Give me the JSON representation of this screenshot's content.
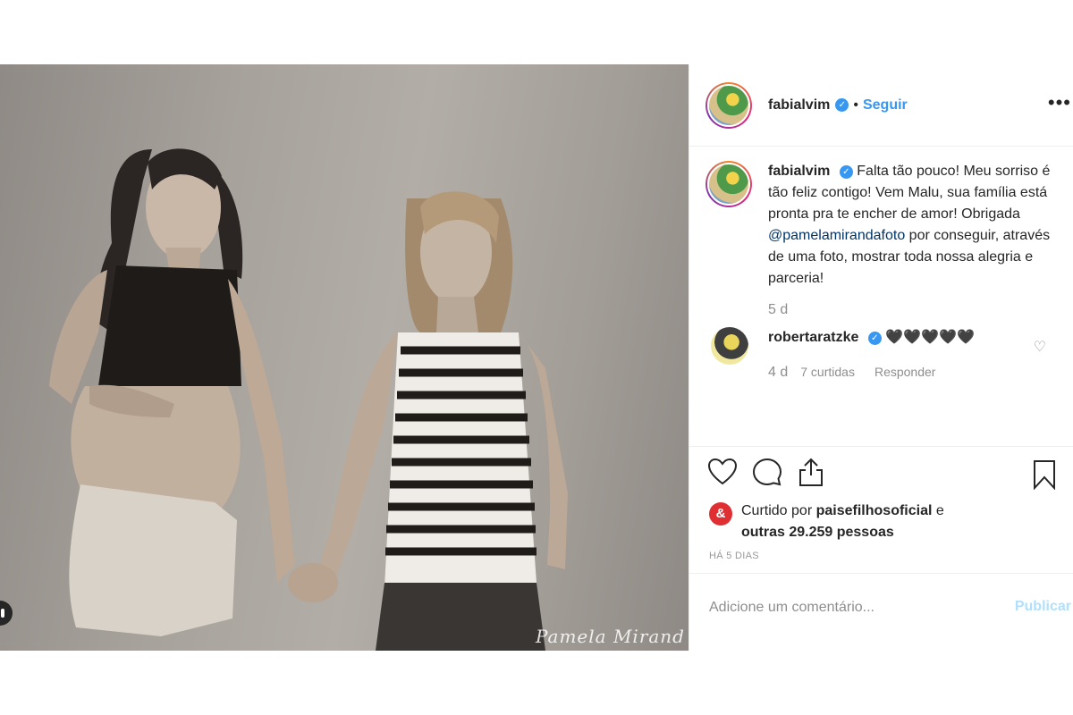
{
  "post": {
    "author": {
      "username": "fabialvim",
      "verified_icon": "verified-badge-icon",
      "separator": "•",
      "follow_label": "Seguir",
      "more_label": "•••"
    },
    "photo": {
      "watermark": "Pamela Mirand"
    },
    "caption": {
      "username": "fabialvim",
      "text_before_mention": "Falta tão pouco! Meu sorriso é tão feliz contigo! Vem Malu, sua família está pronta pra te encher de amor! Obrigada",
      "mention": "@pamelamirandafoto",
      "text_after_mention": "por conseguir, através de uma foto, mostrar toda nossa alegria e parceria!",
      "time": "5 d"
    },
    "comments": [
      {
        "username": "robertaratzke",
        "text": "🖤🖤🖤🖤🖤",
        "time": "4 d",
        "likes": "7 curtidas",
        "reply_label": "Responder",
        "like_icon": "♡"
      }
    ],
    "likes": {
      "badge": "&",
      "prefix": "Curtido por",
      "user": "paisefilhosoficial",
      "connector": "e",
      "others": "outras 29.259 pessoas"
    },
    "posted_ago": "HÁ 5 DIAS",
    "comment_box": {
      "placeholder": "Adicione um comentário...",
      "publish_label": "Publicar"
    },
    "colors": {
      "link_blue": "#3897f0",
      "mention_blue": "#003569",
      "publish_disabled": "#b2dffc",
      "badge_red": "#e02f33"
    }
  }
}
